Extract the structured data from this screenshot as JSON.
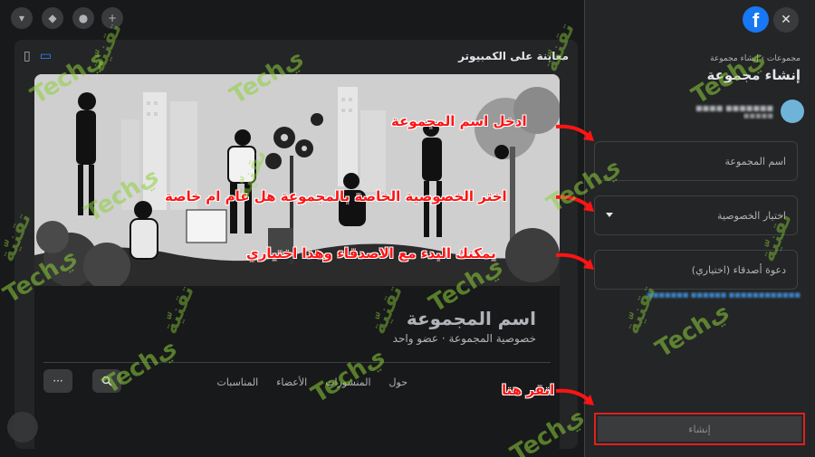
{
  "preview": {
    "title": "معاينة على الكمبيوتر",
    "group_name": "اسم المجموعة",
    "group_meta": "خصوصية المجموعة · عضو واحد",
    "tabs": [
      "حول",
      "المنشورات",
      "الأعضاء",
      "المناسبات"
    ],
    "more_label": "···"
  },
  "panel": {
    "breadcrumb": "مجموعات › إنشاء مجموعة",
    "title": "إنشاء مجموعة",
    "name_placeholder": "اسم المجموعة",
    "privacy_placeholder": "اختيار الخصوصية",
    "invite_placeholder": "دعوة أصدقاء (اختياري)",
    "create_label": "إنشاء"
  },
  "annotations": {
    "enter_name": "ادخل اسم المجموعة",
    "choose_privacy": "اختر الخصوصية الخاصة بالمجموعة هل عام ام خاصة",
    "invite_friends": "يمكنك البدء مع الاصدقاء وهذا اختياري",
    "click_here": "انقر هنا"
  },
  "watermark": {
    "latin": "Techي",
    "arabic": "تقنيّة"
  },
  "colors": {
    "annotation": "#ff1414",
    "highlight_border": "#e02020",
    "facebook_blue": "#1877f2",
    "watermark": "#8ccf3c"
  }
}
